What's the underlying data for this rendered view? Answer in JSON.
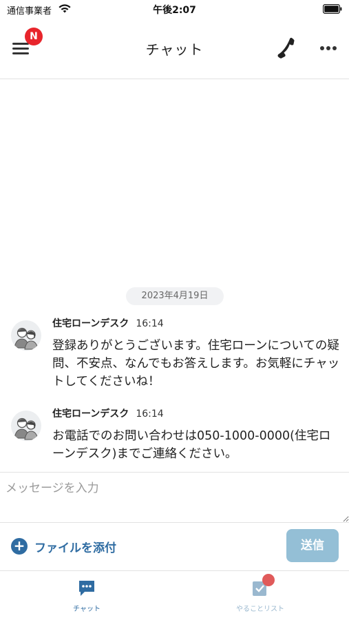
{
  "status_bar": {
    "carrier": "通信事業者",
    "time": "午後2:07"
  },
  "header": {
    "title": "チャット",
    "notification_badge": "N",
    "icons": [
      "menu-icon",
      "phone-icon",
      "more-icon"
    ]
  },
  "chat": {
    "date_label": "2023年4月19日",
    "messages": [
      {
        "sender": "住宅ローンデスク",
        "time": "16:14",
        "text": "登録ありがとうございます。住宅ローンについての疑問、不安点、なんでもお答えします。お気軽にチャットしてくださいね！"
      },
      {
        "sender": "住宅ローンデスク",
        "time": "16:14",
        "text": "お電話でのお問い合わせは050-1000-0000(住宅ローンデスク)までご連絡ください。"
      }
    ]
  },
  "composer": {
    "placeholder": "メッセージを入力",
    "value": "",
    "attach_label": "ファイルを添付",
    "send_label": "送信"
  },
  "tabs": [
    {
      "label": "チャット",
      "icon": "chat-bubble-icon",
      "active": true
    },
    {
      "label": "やることリスト",
      "icon": "checklist-icon",
      "active": false
    }
  ],
  "colors": {
    "accent": "#2f6ca2",
    "send_button": "#94bfd6",
    "badge": "#e8252c",
    "todo_dot": "#e05a5a"
  }
}
